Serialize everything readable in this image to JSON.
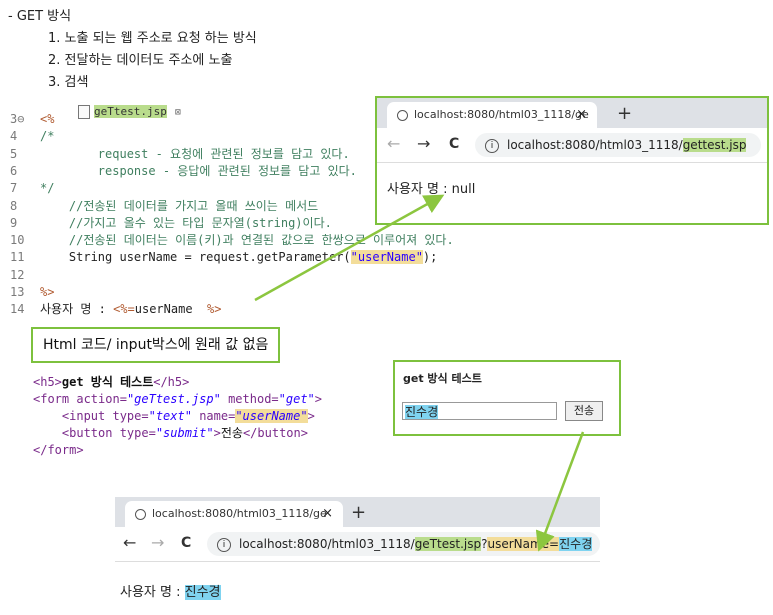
{
  "notes": {
    "heading": "- GET 방식",
    "items": [
      "1. 노출 되는 웹 주소로 요청 하는 방식",
      "2. 전달하는 데이터도 주소에 노출",
      "3. 검색"
    ]
  },
  "editor": {
    "tab_label": "geTtest.jsp",
    "tab_close": "⊠",
    "lines": [
      {
        "n": "3⊖",
        "parts": [
          {
            "t": "<%",
            "c": "tag"
          }
        ]
      },
      {
        "n": "4",
        "parts": [
          {
            "t": "/*",
            "c": "cmt"
          }
        ]
      },
      {
        "n": "5",
        "parts": [
          {
            "t": "        request - 요청에 관련된 정보를 담고 있다.",
            "c": "cmt"
          }
        ]
      },
      {
        "n": "6",
        "parts": [
          {
            "t": "        response - 응답에 관련된 정보를 담고 있다.",
            "c": "cmt"
          }
        ]
      },
      {
        "n": "7",
        "parts": [
          {
            "t": "*/",
            "c": "cmt"
          }
        ]
      },
      {
        "n": "8",
        "parts": [
          {
            "t": "    //전송된 데이터를 가지고 올때 쓰이는 메서드",
            "c": "cmt"
          }
        ]
      },
      {
        "n": "9",
        "parts": [
          {
            "t": "    //가지고 올수 있는 타입 문자열(string)이다.",
            "c": "cmt"
          }
        ]
      },
      {
        "n": "10",
        "parts": [
          {
            "t": "    //전송된 데이터는 이름(키)과 연결된 값으로 한쌍으로 이루어져 있다.",
            "c": "cmt"
          }
        ]
      },
      {
        "n": "11",
        "parts": [
          {
            "t": "    String userName = request.getParameter(",
            "c": "kw"
          },
          {
            "t": "\"userName\"",
            "c": "str-hl"
          },
          {
            "t": ");",
            "c": "kw"
          }
        ]
      },
      {
        "n": "12",
        "parts": []
      },
      {
        "n": "13",
        "parts": [
          {
            "t": "%>",
            "c": "tag"
          }
        ]
      },
      {
        "n": "14",
        "parts": [
          {
            "t": "사용자 명 : ",
            "c": "text"
          },
          {
            "t": "<%=",
            "c": "tag"
          },
          {
            "t": "userName  ",
            "c": "kw"
          },
          {
            "t": "%>",
            "c": "tag"
          }
        ]
      }
    ]
  },
  "browser1": {
    "tab_title": "localhost:8080/html03_1118/ge",
    "tab_close": "×",
    "new_tab": "+",
    "nav_back": "←",
    "nav_forward": "→",
    "nav_reload": "C",
    "info": "i",
    "url_prefix": "localhost:8080/html03_1118/",
    "url_highlight": "gettest.jsp",
    "body_text": "사용자 명 : null"
  },
  "callout": {
    "text": "Html 코드/ input박스에 원래 값 없음"
  },
  "html_code": {
    "line1": {
      "open": "<h5>",
      "text": "get 방식 테스트",
      "close": "</h5>"
    },
    "line2": {
      "open": "<form ",
      "a1": "action=",
      "v1": "\"geTtest.jsp\"",
      "a2": " method=",
      "v2": "\"get\"",
      "end": ">"
    },
    "line3": {
      "open": "    <input ",
      "a1": "type=",
      "v1": "\"text\"",
      "a2": " name=",
      "v2": "\"userName\"",
      "end": ">"
    },
    "line4": {
      "open": "    <button ",
      "a1": "type=",
      "v1": "\"submit\"",
      "gt": ">",
      "text": "전송",
      "close": "</button>"
    },
    "line5": {
      "close": "</form>"
    }
  },
  "form_preview": {
    "title": "get 방식 테스트",
    "input_value": "진수경",
    "button_label": "전송"
  },
  "browser2": {
    "tab_title": "localhost:8080/html03_1118/ge",
    "tab_close": "×",
    "new_tab": "+",
    "nav_back": "←",
    "nav_forward": "→",
    "nav_reload": "C",
    "info": "i",
    "url_prefix": "localhost:8080/html03_1118/",
    "url_file": "geTtest.jsp",
    "url_q": "?",
    "url_param": "userName=",
    "url_value": "진수경",
    "body_label": "사용자 명 : ",
    "body_value": "진수경"
  },
  "colors": {
    "arrow": "#8cc63f",
    "box_border": "#7dc13d",
    "hl_green": "#b9dc8c",
    "hl_yellow": "#f3dd9a",
    "hl_blue": "#7fd3f0"
  },
  "icons": [
    "globe-icon",
    "close-icon",
    "plus-icon",
    "back-arrow-icon",
    "forward-arrow-icon",
    "reload-icon",
    "info-icon",
    "file-icon"
  ]
}
